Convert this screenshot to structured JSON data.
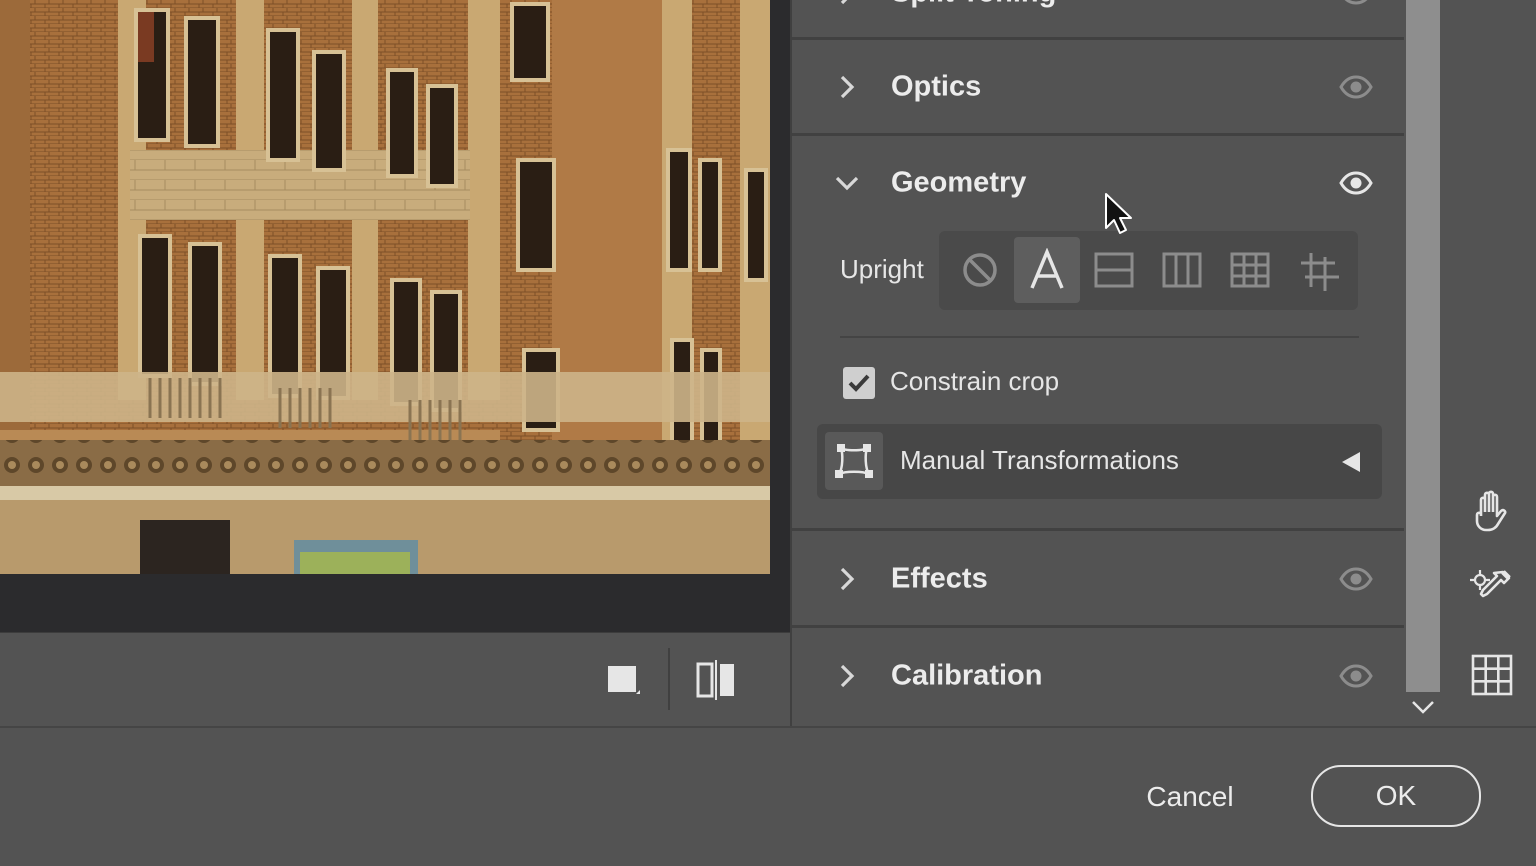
{
  "panel": {
    "sections": {
      "split_toning": {
        "title": "Split Toning",
        "expanded": false
      },
      "optics": {
        "title": "Optics",
        "expanded": false
      },
      "geometry": {
        "title": "Geometry",
        "expanded": true
      },
      "effects": {
        "title": "Effects",
        "expanded": false
      },
      "calibration": {
        "title": "Calibration",
        "expanded": false
      }
    },
    "geometry": {
      "upright_label": "Upright",
      "upright_modes": [
        "off-icon",
        "auto-icon",
        "level-icon",
        "vertical-icon",
        "full-icon",
        "guided-icon"
      ],
      "upright_active_mode": "auto-icon",
      "constrain_crop_label": "Constrain crop",
      "constrain_crop_checked": true,
      "manual_transformations_label": "Manual Transformations"
    }
  },
  "tools": [
    "hand-icon",
    "color-sampler-icon",
    "grid-icon"
  ],
  "footer": {
    "cancel_label": "Cancel",
    "ok_label": "OK"
  },
  "colors": {
    "background": "#535353",
    "panel_separator": "#414141",
    "preview_background": "#2b2b2d",
    "text": "#e6e6e6"
  }
}
